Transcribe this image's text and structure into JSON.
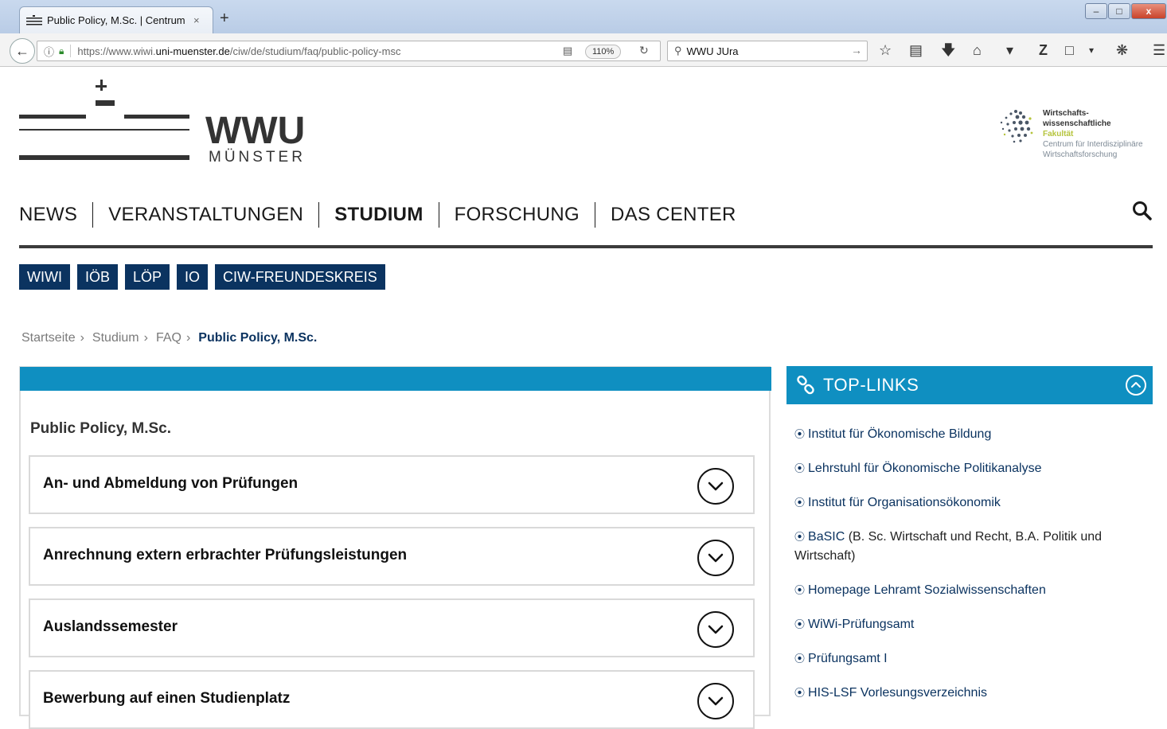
{
  "browser": {
    "tab_title": "Public Policy, M.Sc. | Centrum",
    "tab_close": "×",
    "new_tab": "+",
    "url_prefix": "https://www.wiwi.",
    "url_domain": "uni-muenster.de",
    "url_path": "/ciw/de/studium/faq/public-policy-msc",
    "zoom": "110%",
    "search_value": "WWU JUra",
    "window_controls": {
      "minimize": "–",
      "maximize": "□",
      "close": "x"
    }
  },
  "header": {
    "logo_main": "WWU",
    "logo_sub": "MÜNSTER",
    "faculty_lines": [
      "Wirtschafts-",
      "wissenschaftliche",
      "Fakultät",
      "Centrum für Interdisziplinäre",
      "Wirtschaftsforschung"
    ]
  },
  "mainnav": {
    "items": [
      {
        "label": "NEWS",
        "active": false
      },
      {
        "label": "VERANSTALTUNGEN",
        "active": false
      },
      {
        "label": "STUDIUM",
        "active": true
      },
      {
        "label": "FORSCHUNG",
        "active": false
      },
      {
        "label": "DAS CENTER",
        "active": false
      }
    ]
  },
  "subnav": {
    "items": [
      "WIWI",
      "IÖB",
      "LÖP",
      "IO",
      "CIW-FREUNDESKREIS"
    ]
  },
  "breadcrumb": {
    "items": [
      "Startseite",
      "Studium",
      "FAQ"
    ],
    "separator": "›",
    "current": "Public Policy, M.Sc."
  },
  "main": {
    "title": "Public Policy, M.Sc.",
    "accordion": [
      "An- und Abmeldung von Prüfungen",
      "Anrechnung extern erbrachter Prüfungsleistungen",
      "Auslandssemester",
      "Bewerbung auf einen Studienplatz"
    ]
  },
  "sidebar": {
    "title": "TOP-LINKS",
    "bullet": "⦿",
    "links": [
      {
        "link": "Institut für Ökonomische Bildung",
        "rest": ""
      },
      {
        "link": "Lehrstuhl für Ökonomische Politikanalyse",
        "rest": ""
      },
      {
        "link": "Institut für Organisationsökonomik",
        "rest": ""
      },
      {
        "link": "BaSIC",
        "rest": " (B. Sc. Wirtschaft und Recht, B.A. Politik und Wirtschaft)"
      },
      {
        "link": "Homepage Lehramt Sozialwissenschaften",
        "rest": ""
      },
      {
        "link": "WiWi-Prüfungsamt",
        "rest": ""
      },
      {
        "link": "Prüfungsamt I",
        "rest": ""
      },
      {
        "link": "HIS-LSF Vorlesungsverzeichnis",
        "rest": ""
      }
    ]
  },
  "colors": {
    "navy": "#0b3360",
    "cyan": "#0f8fc1",
    "faculty_green": "#b5c43c"
  }
}
